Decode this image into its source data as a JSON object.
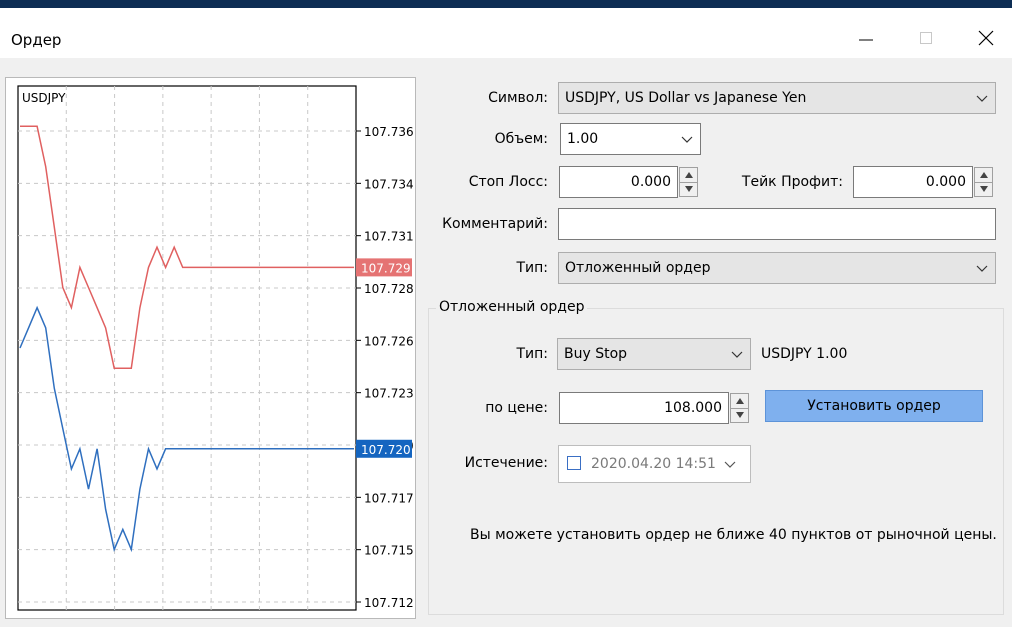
{
  "window": {
    "title": "Ордер",
    "controls": [
      "minimize-icon",
      "maximize-icon",
      "close-icon"
    ]
  },
  "chart": {
    "symbol": "USDJPY",
    "axis_ticks": [
      "107.736",
      "107.734",
      "107.731",
      "107.728",
      "107.726",
      "107.723",
      "107.720",
      "107.717",
      "107.715",
      "107.712"
    ],
    "ask_label": "107.729",
    "bid_label": "107.720",
    "colors": {
      "ask": "#e06060",
      "bid": "#2f6fbf",
      "ask_tag": "#e57373",
      "bid_tag": "#1565c0",
      "grid": "#c8c8c8"
    }
  },
  "chart_data": {
    "type": "line",
    "title": "USDJPY",
    "xlabel": "",
    "ylabel": "",
    "ylim": [
      107.712,
      107.738
    ],
    "grid": true,
    "series": [
      {
        "name": "",
        "color": "#e06060",
        "values": [
          107.736,
          107.736,
          107.736,
          107.734,
          107.731,
          107.728,
          107.727,
          107.729,
          107.728,
          107.727,
          107.726,
          107.724,
          107.724,
          107.724,
          107.727,
          107.729,
          107.73,
          107.729,
          107.73,
          107.729,
          107.729,
          107.729,
          107.729,
          107.729,
          107.729,
          107.729,
          107.729,
          107.729,
          107.729,
          107.729,
          107.729,
          107.729,
          107.729,
          107.729,
          107.729,
          107.729,
          107.729,
          107.729,
          107.729,
          107.729
        ]
      },
      {
        "name": "",
        "color": "#2f6fbf",
        "values": [
          107.725,
          107.726,
          107.727,
          107.726,
          107.723,
          107.721,
          107.719,
          107.72,
          107.718,
          107.72,
          107.717,
          107.715,
          107.716,
          107.715,
          107.718,
          107.72,
          107.719,
          107.72,
          107.72,
          107.72,
          107.72,
          107.72,
          107.72,
          107.72,
          107.72,
          107.72,
          107.72,
          107.72,
          107.72,
          107.72,
          107.72,
          107.72,
          107.72,
          107.72,
          107.72,
          107.72,
          107.72,
          107.72,
          107.72,
          107.72
        ]
      }
    ]
  },
  "form": {
    "symbol_label": "Символ:",
    "symbol_value": "USDJPY, US Dollar vs Japanese Yen",
    "volume_label": "Объем:",
    "volume_value": "1.00",
    "sl_label": "Стоп Лосс:",
    "sl_value": "0.000",
    "tp_label": "Тейк Профит:",
    "tp_value": "0.000",
    "comment_label": "Комментарий:",
    "comment_value": "",
    "type_label": "Тип:",
    "type_value": "Отложенный ордер"
  },
  "pending": {
    "group_title": "Отложенный ордер",
    "type_label": "Тип:",
    "type_value": "Buy Stop",
    "type_info": "USDJPY 1.00",
    "price_label": "по цене:",
    "price_value": "108.000",
    "submit_label": "Установить ордер",
    "expiry_label": "Истечение:",
    "expiry_value": "2020.04.20 14:51",
    "expiry_checked": false,
    "note": "Вы можете установить ордер не ближе 40 пунктов от рыночной цены."
  }
}
